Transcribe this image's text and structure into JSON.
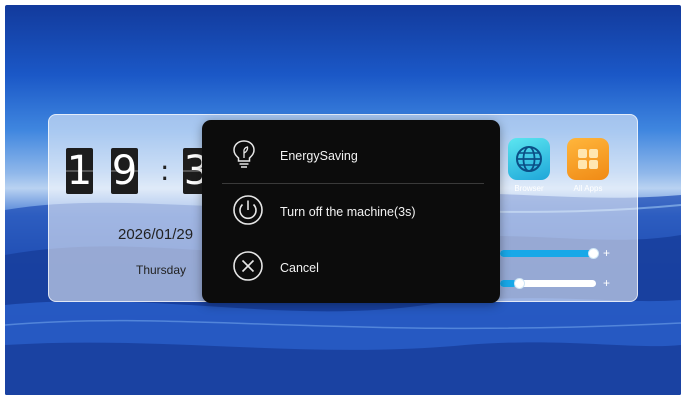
{
  "clock": {
    "hour_tens": "1",
    "hour_ones": "9",
    "separator": ":",
    "minute_tens": "3",
    "date": "2026/01/29",
    "weekday": "Thursday"
  },
  "apps": [
    {
      "label": "Browser",
      "icon": "globe-icon"
    },
    {
      "label": "All Apps",
      "icon": "grid-icon"
    }
  ],
  "sliders": [
    {
      "name": "volume",
      "level_percent": 97,
      "plus": "+"
    },
    {
      "name": "brightness",
      "level_percent": 10,
      "plus": "+"
    }
  ],
  "power_menu": {
    "items": [
      {
        "label": "EnergySaving",
        "icon": "lightbulb-icon"
      },
      {
        "label": "Turn off the machine(3s)",
        "icon": "power-icon"
      },
      {
        "label": "Cancel",
        "icon": "close-circle-icon"
      }
    ]
  },
  "colors": {
    "popup_bg": "#0c0c0c",
    "accent": "#18a8e8",
    "browser_icon": "#1ea6d9",
    "all_apps_icon": "#f08a15"
  }
}
